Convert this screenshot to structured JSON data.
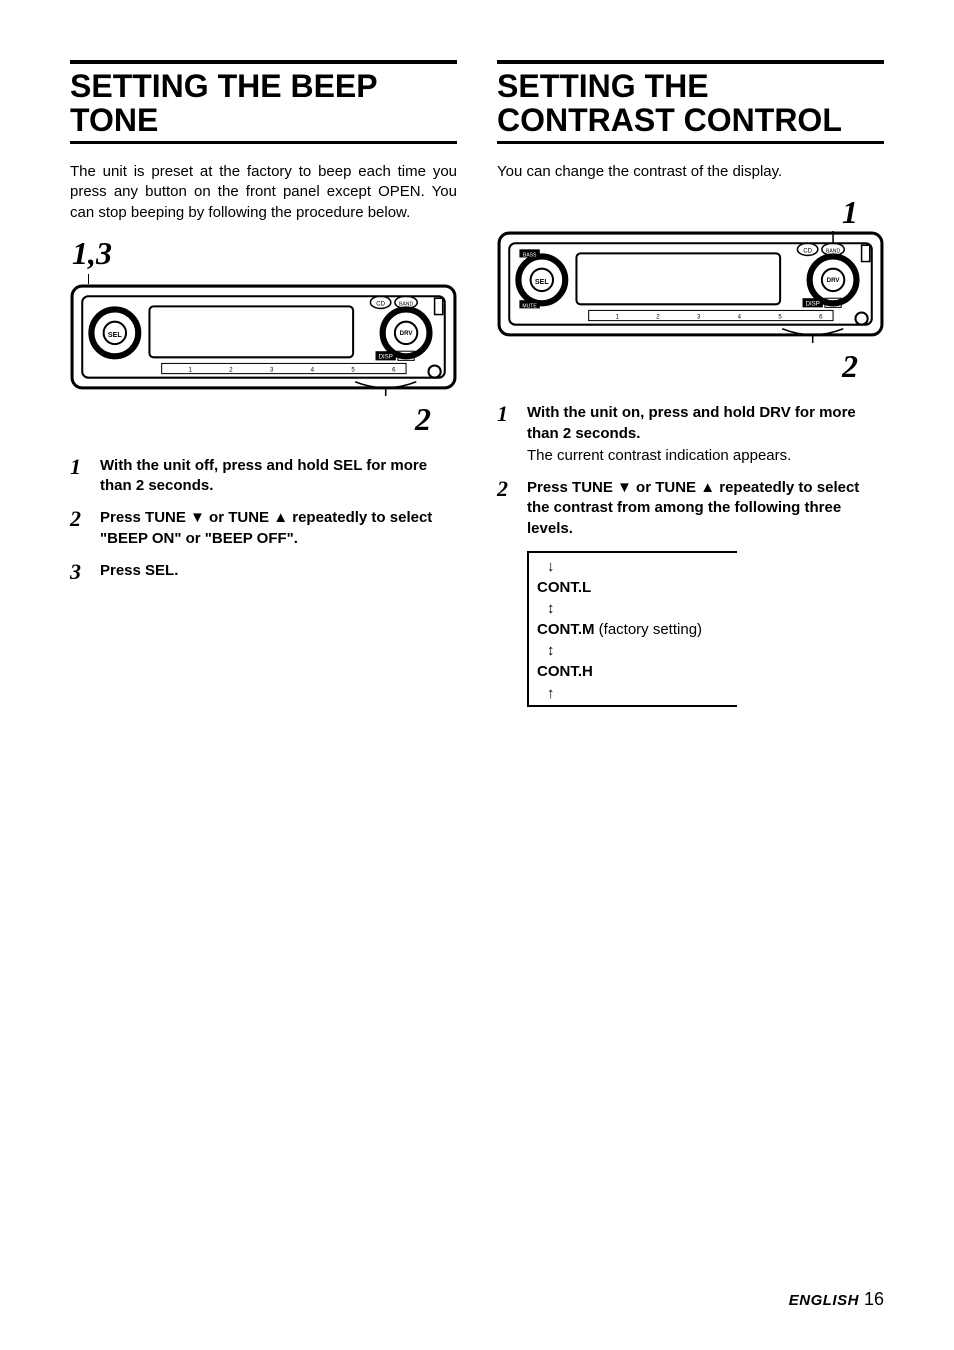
{
  "left": {
    "title": "SETTING THE BEEP TONE",
    "intro": "The unit is preset at the factory to beep each time you press any button on the front panel except OPEN. You can stop beeping by following the procedure below.",
    "callout_top": "1,3",
    "callout_bottom": "2",
    "steps": [
      {
        "n": "1",
        "bold": "With the unit off, press and hold SEL for more than 2 seconds."
      },
      {
        "n": "2",
        "bold": "Press TUNE ▼ or TUNE ▲ repeatedly to select \"BEEP ON\" or \"BEEP OFF\"."
      },
      {
        "n": "3",
        "bold": "Press SEL."
      }
    ]
  },
  "right": {
    "title": "SETTING THE CONTRAST CONTROL",
    "intro": "You can change the contrast of the display.",
    "callout_top": "1",
    "callout_bottom": "2",
    "steps": [
      {
        "n": "1",
        "bold": "With the unit on, press and hold DRV for more than 2 seconds.",
        "sub": "The current contrast indication appears."
      },
      {
        "n": "2",
        "bold": "Press TUNE ▼ or TUNE ▲ repeatedly to select the contrast from among the following three levels."
      }
    ],
    "levels": {
      "l": "CONT.L",
      "m": "CONT.M",
      "m_note": " (factory setting)",
      "h": "CONT.H"
    }
  },
  "footer": {
    "lang": "ENGLISH",
    "page": "16"
  }
}
